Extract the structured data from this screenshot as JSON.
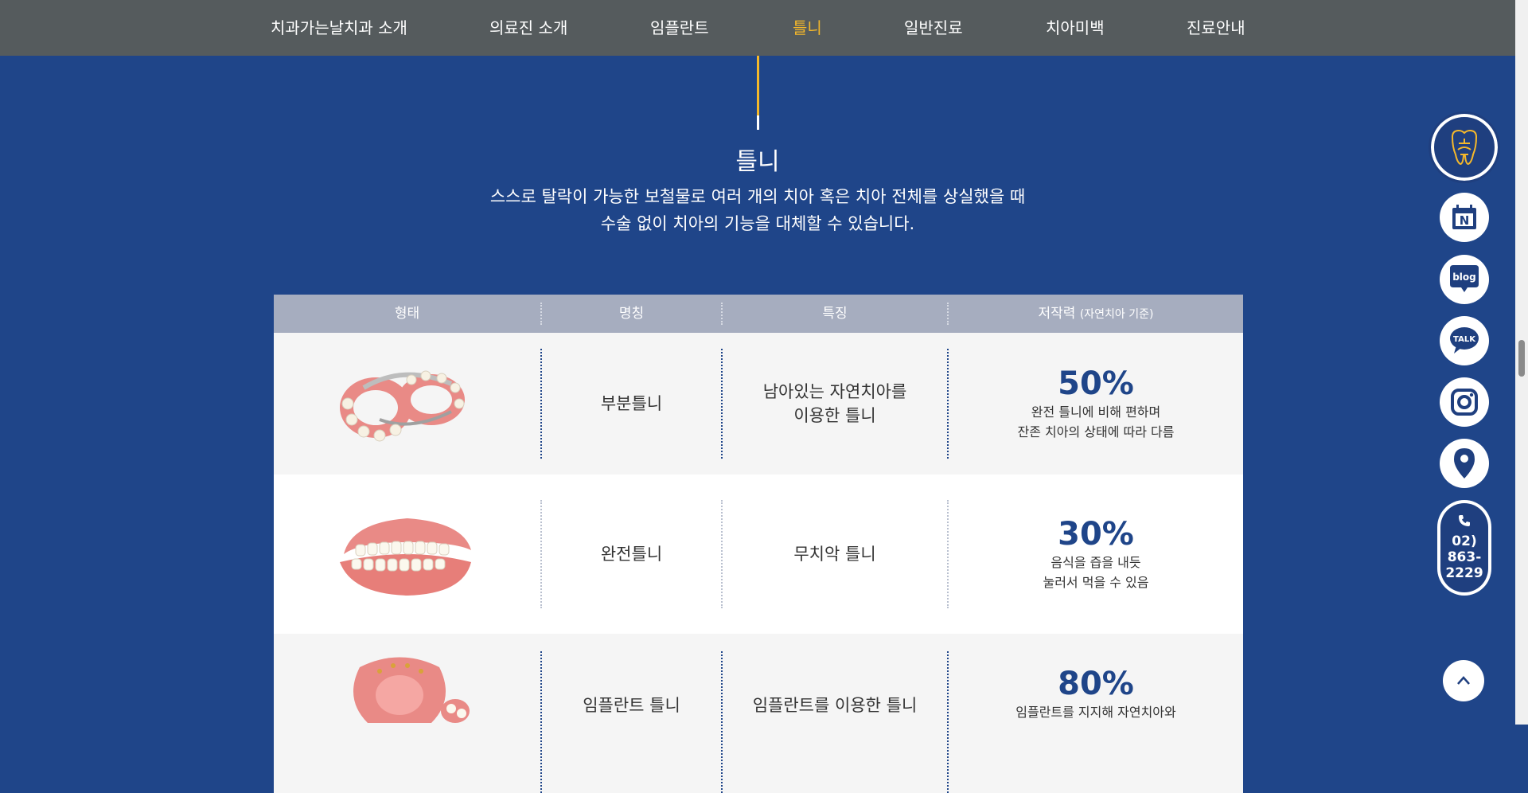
{
  "nav": {
    "items": [
      {
        "label": "치과가는날치과 소개",
        "active": false
      },
      {
        "label": "의료진 소개",
        "active": false
      },
      {
        "label": "임플란트",
        "active": false
      },
      {
        "label": "틀니",
        "active": true
      },
      {
        "label": "일반진료",
        "active": false
      },
      {
        "label": "치아미백",
        "active": false
      },
      {
        "label": "진료안내",
        "active": false
      }
    ]
  },
  "section": {
    "title": "틀니",
    "desc_line1": "스스로 탈락이 가능한 보철물로 여러 개의 치아 혹은 치아 전체를 상실했을 때",
    "desc_line2": "수술 없이 치아의 기능을 대체할 수 있습니다."
  },
  "table": {
    "headers": {
      "shape": "형태",
      "name": "명칭",
      "feature": "특징",
      "force": "저작력",
      "force_sub": "(자연치아 기준)"
    },
    "rows": [
      {
        "image": "partial-denture-image",
        "name": "부분틀니",
        "feature_1": "남아있는 자연치아를",
        "feature_2": "이용한 틀니",
        "percent": "50%",
        "note_1": "완전 틀니에 비해 편하며",
        "note_2": "잔존 치아의 상태에 따라 다름"
      },
      {
        "image": "complete-denture-image",
        "name": "완전틀니",
        "feature_1": "무치악 틀니",
        "feature_2": "",
        "percent": "30%",
        "note_1": "음식을 즙을 내듯",
        "note_2": "눌러서 먹을 수 있음"
      },
      {
        "image": "implant-denture-image",
        "name": "임플란트 틀니",
        "feature_1": "임플란트를 이용한 틀니",
        "feature_2": "",
        "percent": "80%",
        "note_1": "임플란트를 지지해 자연치아와",
        "note_2": ""
      }
    ]
  },
  "quick": {
    "logo_icon": "tooth-logo-icon",
    "items": [
      "naver-icon",
      "blog-icon",
      "talk-icon",
      "instagram-icon",
      "location-icon"
    ],
    "blog_label": "blog",
    "talk_label": "TALK",
    "naver_label": "N",
    "phone_line1": "02)",
    "phone_line2": "863-",
    "phone_line3": "2229"
  },
  "colors": {
    "background": "#1f4589",
    "nav_bg": "#555b5d",
    "accent": "#f5b82a",
    "header_bg": "#a6adbf"
  }
}
